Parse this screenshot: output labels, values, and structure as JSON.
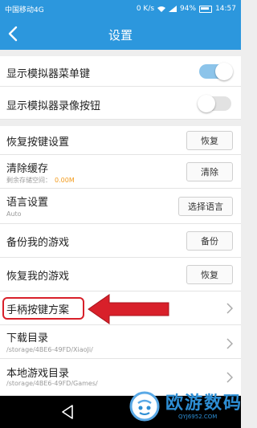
{
  "status_bar": {
    "carrier": "中国移动4G",
    "speed": "0 K/s",
    "battery": "94%",
    "time": "14:57"
  },
  "header": {
    "title": "设置",
    "back_icon": "chevron-left-icon"
  },
  "settings": {
    "show_menu_key": {
      "label": "显示模拟器菜单键",
      "enabled": true
    },
    "show_record_button": {
      "label": "显示模拟器录像按钮",
      "enabled": false
    },
    "restore_key_settings": {
      "label": "恢复按键设置",
      "button": "恢复"
    },
    "clear_cache": {
      "label": "清除缓存",
      "subtitle": "剩余存储空间：",
      "size": "0.00M",
      "button": "清除"
    },
    "language": {
      "label": "语言设置",
      "value": "Auto",
      "button": "选择语言"
    },
    "backup_games": {
      "label": "备份我的游戏",
      "button": "备份"
    },
    "restore_games": {
      "label": "恢复我的游戏",
      "button": "恢复"
    },
    "gamepad_scheme": {
      "label": "手柄按键方案"
    },
    "download_dir": {
      "label": "下载目录",
      "path": "/storage/4BE6-49FD/XiaoJi/"
    },
    "local_games_dir": {
      "label": "本地游戏目录",
      "path": "/storage/4BE6-49FD/Games/"
    }
  },
  "annotation": {
    "color": "#d8202a"
  },
  "watermark": {
    "name": "欧游数码",
    "url": "QYJ6952.COM"
  },
  "colors": {
    "accent": "#2c97dd",
    "toggle_on": "#8cc4ea",
    "orange": "#f39b1c"
  }
}
